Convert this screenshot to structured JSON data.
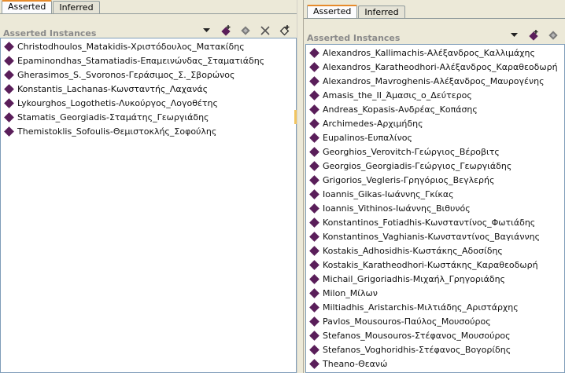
{
  "left": {
    "tabs": [
      "Asserted",
      "Inferred"
    ],
    "header_title": "Asserted Instances",
    "items": [
      "Christodhoulos_Matakidis-Χριστόδουλος_Ματακίδης",
      "Epaminondhas_Stamatiadis-Επαμεινώνδας_Σταματιάδης",
      "Gherasimos_S._Svoronos-Γεράσιμος_Σ._Σβορώνος",
      "Konstantis_Lachanas-Κωνσταντής_Λαχανάς",
      "Lykourghos_Logothetis-Λυκούργος_Λογοθέτης",
      "Stamatis_Georgiadis-Σταμάτης_Γεωργιάδης",
      "Themistoklis_Sofoulis-Θεμιστοκλής_Σοφούλης"
    ]
  },
  "right": {
    "tabs": [
      "Asserted",
      "Inferred"
    ],
    "header_title": "Asserted Instances",
    "items": [
      "Alexandros_Kallimachis-Αλέξανδρος_Καλλιμάχης",
      "Alexandros_Karatheodhori-Αλέξανδρος_Καραθεοδωρή",
      "Alexandros_Mavroghenis-Αλέξανδρος_Μαυρογένης",
      "Amasis_the_II_Άμασις_ο_Δεύτερος",
      "Andreas_Kopasis-Ανδρέας_Κοπάσης",
      "Archimedes-Αρχιμήδης",
      "Eupalinos-Ευπαλίνος",
      "Georghios_Verovitch-Γεώργιος_Βέροβιτς",
      "Georgios_Georgiadis-Γεώργιος_Γεωργιάδης",
      "Grigorios_Vegleris-Γρηγόριος_Βεγλερής",
      "Ioannis_Gikas-Ιωάννης_Γκίκας",
      "Ioannis_Vithinos-Ιωάννης_Βιθυνός",
      "Konstantinos_Fotiadhis-Κωνσταντίνος_Φωτιάδης",
      "Konstantinos_Vaghianis-Κωνσταντίνος_Βαγιάννης",
      "Kostakis_Adhosidhis-Κωστάκης_Αδοσίδης",
      "Kostakis_Karatheodhori-Κωστάκης_Καραθεοδωρή",
      "Michail_Grigoriadhis-Μιχαήλ_Γρηγοριάδης",
      "Milon_Μίλων",
      "Miltiadhis_Aristarchis-Μιλτιάδης_Αριστάρχης",
      "Pavlos_Mousouros-Παύλος_Μουσούρος",
      "Stefanos_Mousouros-Στέφανος_Μουσούρος",
      "Stefanos_Voghoridhis-Στέφανος_Βογορίδης",
      "Theano-Θεανώ"
    ]
  },
  "colors": {
    "diamond": "#5a1e5a",
    "tab_active_top": "#e68b2c",
    "background": "#ece9d8"
  },
  "icons": {
    "left_toolbar": [
      "dropdown-arrow-icon",
      "add-instance-icon",
      "copy-instance-icon",
      "delete-instance-icon",
      "create-instance-icon"
    ],
    "right_toolbar": [
      "dropdown-arrow-icon",
      "add-instance-icon",
      "copy-instance-icon"
    ]
  }
}
